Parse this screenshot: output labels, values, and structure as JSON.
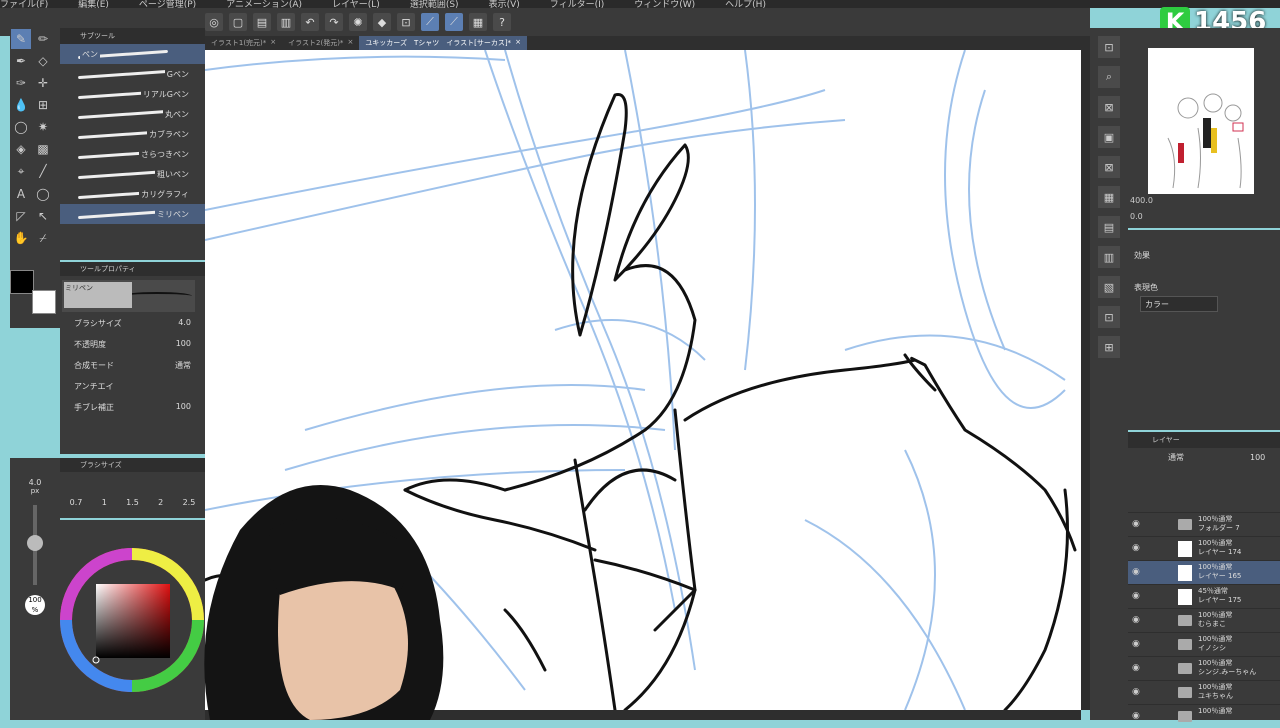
{
  "menu": [
    "ファイル(F)",
    "編集(E)",
    "ページ管理(P)",
    "アニメーション(A)",
    "レイヤー(L)",
    "選択範囲(S)",
    "表示(V)",
    "フィルター(I)",
    "ウィンドウ(W)",
    "ヘルプ(H)"
  ],
  "tabs": [
    {
      "label": "イラスト1(完元)*"
    },
    {
      "label": "イラスト2(発元)*"
    },
    {
      "label": "ユキッカーズ　Tシャツ　イラスト[サーカス]*"
    }
  ],
  "score": {
    "letter": "K",
    "value": "1456"
  },
  "subtool": {
    "header": "サブツール",
    "group": "ペン",
    "brushes": [
      "Gペン",
      "リアルGペン",
      "丸ペン",
      "カブラペン",
      "さらつきペン",
      "粗いペン",
      "カリグラフィ",
      "ミリペン"
    ]
  },
  "tool_property": {
    "header": "ツールプロパティ",
    "preview_label": "ミリペン",
    "rows": [
      {
        "label": "ブラシサイズ",
        "value": "4.0"
      },
      {
        "label": "不透明度",
        "value": "100"
      },
      {
        "label": "合成モード",
        "value": "通常"
      },
      {
        "label": "アンチエイ",
        "value": ""
      },
      {
        "label": "手ブレ補正",
        "value": "100"
      }
    ]
  },
  "brush_size": {
    "header": "ブラシサイズ",
    "current": "4.0",
    "unit": "px",
    "values": [
      "0.7",
      "1",
      "1.5",
      "2",
      "2.5"
    ],
    "opacity": "100",
    "opacity_unit": "%"
  },
  "navigator": {
    "zoom": "400.0",
    "rotation": "0.0"
  },
  "layer_property": {
    "effect_label": "効果",
    "color_label": "表現色",
    "color_value": "カラー"
  },
  "layers_panel": {
    "header": "レイヤー",
    "blend": "通常",
    "opacity": "100",
    "items": [
      {
        "line1": "100％通常",
        "line2": "フォルダー 7",
        "type": "folder"
      },
      {
        "line1": "100％通常",
        "line2": "レイヤー 174",
        "type": "layer"
      },
      {
        "line1": "100％通常",
        "line2": "レイヤー 165",
        "type": "layer",
        "selected": true
      },
      {
        "line1": "45％通常",
        "line2": "レイヤー 175",
        "type": "layer"
      },
      {
        "line1": "100％通常",
        "line2": "むらまこ",
        "type": "folder"
      },
      {
        "line1": "100％通常",
        "line2": "イノシシ",
        "type": "folder"
      },
      {
        "line1": "100％通常",
        "line2": "シンジ.みーちゃん",
        "type": "folder"
      },
      {
        "line1": "100％通常",
        "line2": "ユキちゃん",
        "type": "folder"
      },
      {
        "line1": "100％通常",
        "line2": "",
        "type": "folder"
      }
    ]
  },
  "colors": {
    "accent": "#5c7fb3",
    "panel": "#3a3a3a",
    "sketch": "#8fb8e8",
    "ink": "#111111"
  }
}
